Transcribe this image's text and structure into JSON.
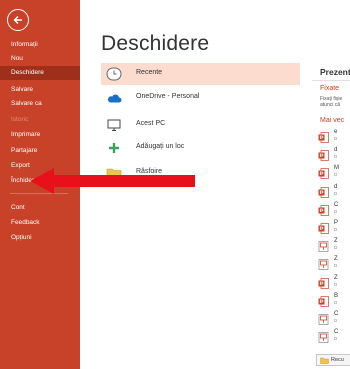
{
  "sidebar": {
    "items": [
      {
        "label": "Informații",
        "state": "normal"
      },
      {
        "label": "Nou",
        "state": "normal"
      },
      {
        "label": "Deschidere",
        "state": "active"
      },
      {
        "label": "Salvare",
        "state": "normal"
      },
      {
        "label": "Salvare ca",
        "state": "normal"
      },
      {
        "label": "Istoric",
        "state": "disabled"
      },
      {
        "label": "Imprimare",
        "state": "normal"
      },
      {
        "label": "Partajare",
        "state": "normal"
      },
      {
        "label": "Export",
        "state": "normal"
      },
      {
        "label": "Închidere",
        "state": "normal"
      },
      {
        "label": "Cont",
        "state": "normal"
      },
      {
        "label": "Feedback",
        "state": "normal"
      },
      {
        "label": "Opțiuni",
        "state": "normal"
      }
    ]
  },
  "main": {
    "title": "Deschidere",
    "locations": [
      {
        "label": "Recente",
        "icon": "clock-icon",
        "selected": true
      },
      {
        "label": "OneDrive - Personal",
        "icon": "cloud-icon",
        "selected": false
      },
      {
        "label": "Acest PC",
        "icon": "computer-icon",
        "selected": false
      },
      {
        "label": "Adăugați un loc",
        "icon": "plus-icon",
        "selected": false
      },
      {
        "label": "Răsfoire",
        "icon": "folder-icon",
        "selected": false
      }
    ]
  },
  "right": {
    "section_title": "Prezent",
    "pinned_label": "Fixate",
    "pinned_text_1": "Fixați fișie",
    "pinned_text_2": "atunci că",
    "older_label": "Mai vec",
    "recent_files": [
      {
        "name": "e",
        "path": "D",
        "type": "pptx"
      },
      {
        "name": "d",
        "path": "D",
        "type": "pptx"
      },
      {
        "name": "M",
        "path": "D",
        "type": "pptx"
      },
      {
        "name": "d",
        "path": "D",
        "type": "pptx"
      },
      {
        "name": "C",
        "path": "D",
        "type": "pptx"
      },
      {
        "name": "P",
        "path": "D",
        "type": "pptx"
      },
      {
        "name": "Z",
        "path": "D",
        "type": "ppsx"
      },
      {
        "name": "Z",
        "path": "D",
        "type": "ppsx"
      },
      {
        "name": "Z",
        "path": "D",
        "type": "pptx"
      },
      {
        "name": "B",
        "path": "D",
        "type": "pptx"
      },
      {
        "name": "C",
        "path": "D",
        "type": "ppsx"
      },
      {
        "name": "C",
        "path": "D",
        "type": "ppsx"
      }
    ],
    "recover_label": "Recu"
  },
  "colors": {
    "sidebar_bg": "#c74228",
    "sidebar_active": "#9d2f1b",
    "selected_bg": "#fbdccf",
    "arrow": "#e8101a"
  }
}
